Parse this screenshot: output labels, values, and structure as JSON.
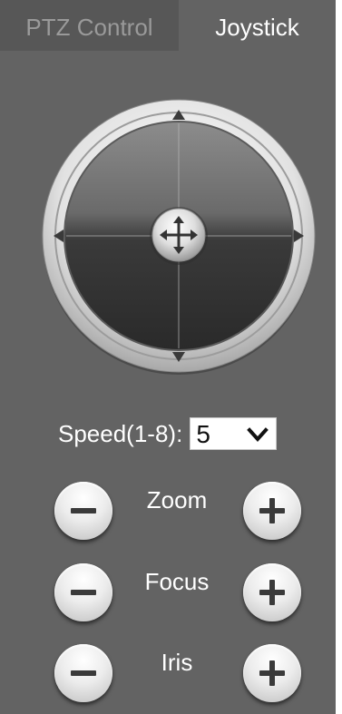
{
  "tabs": {
    "ptz_control": "PTZ Control",
    "joystick": "Joystick"
  },
  "joystick": {
    "icons": [
      "arrow-up-icon",
      "arrow-down-icon",
      "arrow-left-icon",
      "arrow-right-icon",
      "move-center-icon"
    ]
  },
  "speed": {
    "label": "Speed(1-8):",
    "value": "5"
  },
  "controls": {
    "zoom": "Zoom",
    "focus": "Focus",
    "iris": "Iris"
  },
  "colors": {
    "panel_bg": "#636363",
    "inactive_tab_bg": "#575757",
    "inactive_tab_text": "#9a9a9a",
    "active_tab_text": "#ffffff"
  }
}
